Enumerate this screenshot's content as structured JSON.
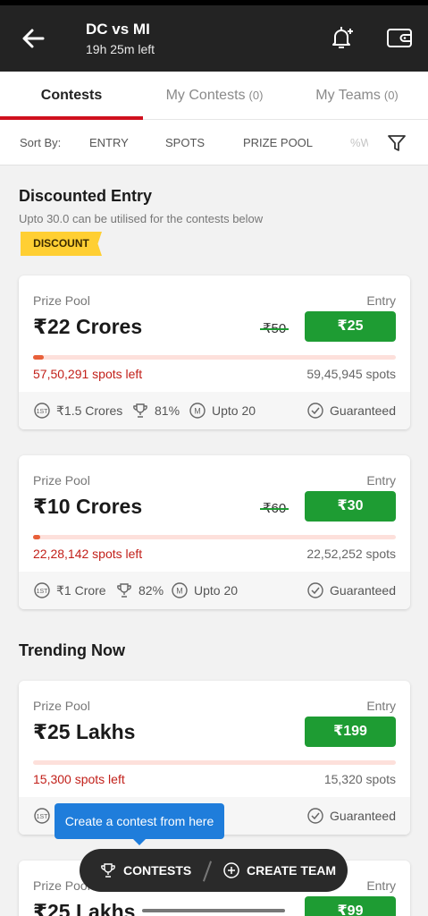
{
  "header": {
    "title": "DC vs MI",
    "time_left": "19h 25m left"
  },
  "tabs": [
    {
      "label": "Contests",
      "count": ""
    },
    {
      "label": "My Contests",
      "count": "(0)"
    },
    {
      "label": "My Teams",
      "count": "(0)"
    }
  ],
  "sort": {
    "label": "Sort By:",
    "options": [
      "ENTRY",
      "SPOTS",
      "PRIZE POOL",
      "%W"
    ]
  },
  "sections": {
    "discounted_title": "Discounted Entry",
    "discounted_sub": "Upto 30.0 can be utilised for the contests below",
    "discount_badge": "DISCOUNT",
    "trending_title": "Trending Now"
  },
  "contests": [
    {
      "prize_label": "Prize Pool",
      "entry_label": "Entry",
      "prize": "₹22 Crores",
      "original_entry": "₹50",
      "entry": "₹25",
      "spots_left": "57,50,291 spots left",
      "total_spots": "59,45,945 spots",
      "fill_fraction": 0.03,
      "first_prize": "₹1.5 Crores",
      "win_percent": "81%",
      "max_teams": "Upto 20",
      "guaranteed": "Guaranteed"
    },
    {
      "prize_label": "Prize Pool",
      "entry_label": "Entry",
      "prize": "₹10 Crores",
      "original_entry": "₹60",
      "entry": "₹30",
      "spots_left": "22,28,142 spots left",
      "total_spots": "22,52,252 spots",
      "fill_fraction": 0.02,
      "first_prize": "₹1 Crore",
      "win_percent": "82%",
      "max_teams": "Upto 20",
      "guaranteed": "Guaranteed"
    },
    {
      "prize_label": "Prize Pool",
      "entry_label": "Entry",
      "prize": "₹25 Lakhs",
      "entry": "₹199",
      "spots_left": "15,300 spots left",
      "total_spots": "15,320 spots",
      "fill_fraction": 0.0,
      "guaranteed": "Guaranteed"
    },
    {
      "prize_label": "Prize Pool",
      "entry_label": "Entry",
      "prize": "₹25 Lakhs",
      "entry": "₹99"
    }
  ],
  "tooltip": "Create a contest from here",
  "bottom_bar": {
    "contests": "CONTESTS",
    "create_team": "CREATE TEAM"
  },
  "colors": {
    "accent_red": "#d0101e",
    "entry_green": "#1e9c33",
    "header_bg": "#232323",
    "tooltip_blue": "#1f7ddb"
  }
}
